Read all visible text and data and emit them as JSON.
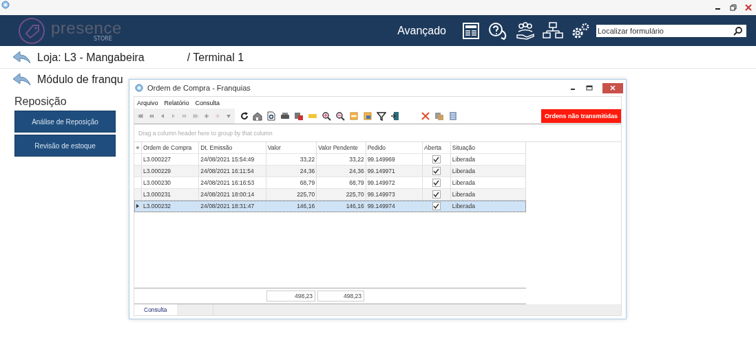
{
  "app": {
    "logo_name": "presence",
    "logo_sub": "STORE",
    "section": "Avançado",
    "search": {
      "placeholder": "Localizar formulário"
    }
  },
  "breadcrumb": {
    "store": "Loja: L3 - Mangabeira",
    "terminal": "/ Terminal 1",
    "module": "Módulo de franqu"
  },
  "sidebar": {
    "title": "Reposição",
    "buttons": [
      "Análise de Reposição",
      "Revisão de estoque"
    ]
  },
  "dialog": {
    "title": "Ordem de Compra - Franquias",
    "menu": [
      "Arquivo",
      "Relatório",
      "Consulta"
    ],
    "alert": "Ordens não transmitidas",
    "group_hint": "Drag a column header here to group by that column",
    "columns": [
      "Ordem de Compra",
      "Dt. Emissão",
      "Valor",
      "Valor Pendente",
      "Pedido",
      "Aberta",
      "Situação"
    ],
    "rows": [
      {
        "order": "L3.000227",
        "date": "24/08/2021 15:54:49",
        "value": "33,22",
        "pending": "33,22",
        "pedido": "99.149969",
        "aberta": true,
        "status": "Liberada",
        "selected": false
      },
      {
        "order": "L3.000229",
        "date": "24/08/2021 16:11:54",
        "value": "24,36",
        "pending": "24,36",
        "pedido": "99.149971",
        "aberta": true,
        "status": "Liberada",
        "selected": false
      },
      {
        "order": "L3.000230",
        "date": "24/08/2021 16:16:53",
        "value": "68,79",
        "pending": "68,79",
        "pedido": "99.149972",
        "aberta": true,
        "status": "Liberada",
        "selected": false
      },
      {
        "order": "L3.000231",
        "date": "24/08/2021 18:00:14",
        "value": "225,70",
        "pending": "225,70",
        "pedido": "99.149973",
        "aberta": true,
        "status": "Liberada",
        "selected": false
      },
      {
        "order": "L3.000232",
        "date": "24/08/2021 18:31:47",
        "value": "146,16",
        "pending": "146,16",
        "pedido": "99.149974",
        "aberta": true,
        "status": "Liberada",
        "selected": true
      }
    ],
    "totals": {
      "value": "498,23",
      "pending": "498,23"
    },
    "tabs": [
      {
        "label": "Consulta",
        "selected": true
      }
    ]
  }
}
